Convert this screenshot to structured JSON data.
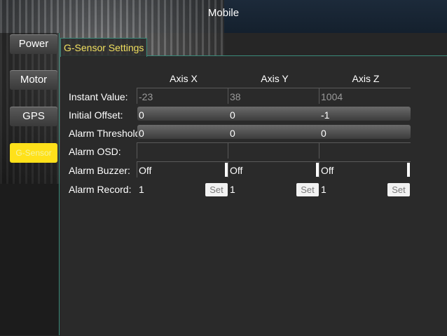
{
  "window": {
    "title": "Mobile"
  },
  "sidebar": {
    "items": [
      {
        "label": "Power"
      },
      {
        "label": "Motor"
      },
      {
        "label": "GPS"
      },
      {
        "label": "G-Sensor",
        "active": true
      }
    ]
  },
  "panel": {
    "tab_label": "G-Sensor Settings",
    "columns": [
      "Axis X",
      "Axis Y",
      "Axis Z"
    ],
    "rows": {
      "instant_value": {
        "label": "Instant Value:",
        "values": [
          "-23",
          "38",
          "1004"
        ]
      },
      "initial_offset": {
        "label": "Initial Offset:",
        "values": [
          "0",
          "0",
          "-1"
        ]
      },
      "alarm_threshold": {
        "label": "Alarm Threshold:",
        "values": [
          "0",
          "0",
          "0"
        ]
      },
      "alarm_osd": {
        "label": "Alarm OSD:"
      },
      "alarm_buzzer": {
        "label": "Alarm Buzzer:",
        "values": [
          "Off",
          "Off",
          "Off"
        ]
      },
      "alarm_record": {
        "label": "Alarm Record:",
        "values": [
          "1",
          "1",
          "1"
        ],
        "button": "Set"
      }
    }
  },
  "colors": {
    "accent_yellow": "#ffe11a",
    "tab_text": "#f1e060",
    "border_teal": "#3a8a7a"
  }
}
